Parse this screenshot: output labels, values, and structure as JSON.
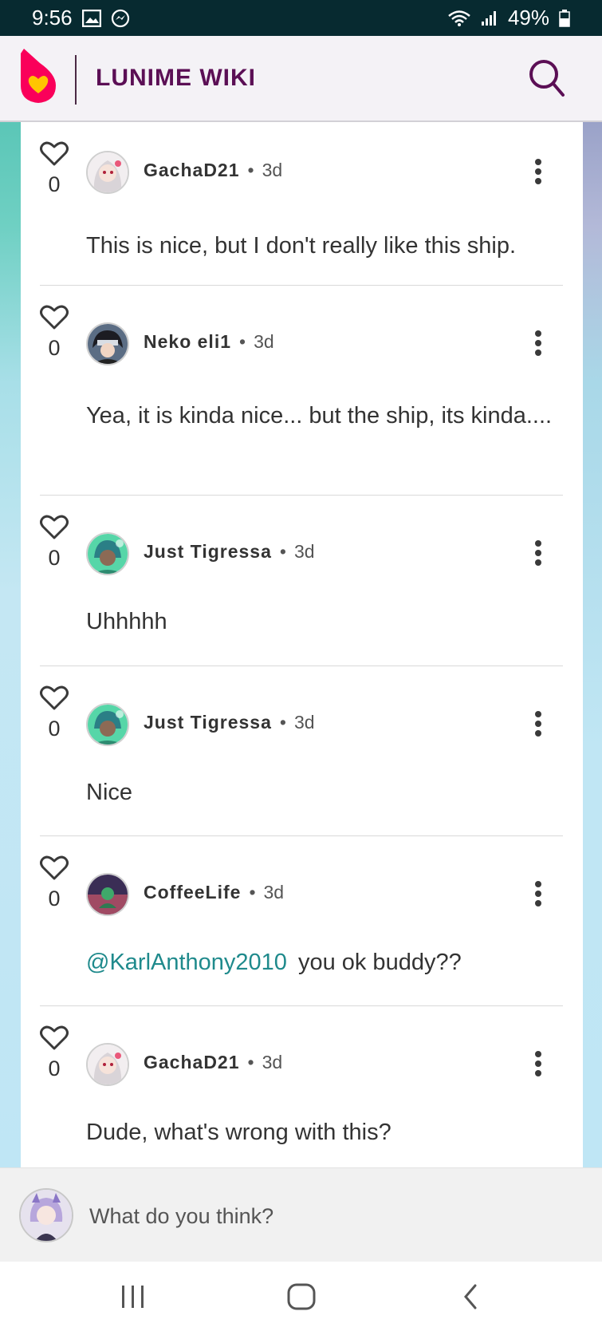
{
  "status_bar": {
    "time": "9:56",
    "battery": "49%",
    "icons": [
      "gallery-icon",
      "messenger-icon",
      "wifi-icon",
      "signal-icon",
      "battery-icon"
    ]
  },
  "app_bar": {
    "title": "LUNIME WIKI",
    "logo_icon": "fandom-flame-logo",
    "search_icon": "search-icon"
  },
  "comments": [
    {
      "author": "GachaD21",
      "time": "3d",
      "likes": "0",
      "text": "This is nice, but I don't really like this ship.",
      "mention": "",
      "avatar_color": "#e8e0e4"
    },
    {
      "author": "Neko eli1",
      "time": "3d",
      "likes": "0",
      "text": "Yea, it is kinda nice... but the ship, its kinda....",
      "mention": "",
      "avatar_color": "#3c4656"
    },
    {
      "author": "Just Tigressa",
      "time": "3d",
      "likes": "0",
      "text": "Uhhhhh",
      "mention": "",
      "avatar_color": "#3fc59a"
    },
    {
      "author": "Just Tigressa",
      "time": "3d",
      "likes": "0",
      "text": "Nice",
      "mention": "",
      "avatar_color": "#3fc59a"
    },
    {
      "author": "CoffeeLife",
      "time": "3d",
      "likes": "0",
      "text": "you ok buddy??",
      "mention": "@KarlAnthony2010",
      "avatar_color": "#6a2c5a"
    },
    {
      "author": "GachaD21",
      "time": "3d",
      "likes": "0",
      "text": "Dude, what's wrong with this?",
      "mention": "",
      "avatar_color": "#e8e0e4"
    }
  ],
  "composer": {
    "placeholder": "What do you think?"
  },
  "nav_bar": {
    "buttons": [
      "recent-apps-icon",
      "home-icon",
      "back-icon"
    ]
  },
  "colors": {
    "brand_purple": "#5b0f55",
    "status_bar_bg": "#072a30",
    "mention_teal": "#1f8a8c",
    "logo_pink": "#fa005a"
  }
}
